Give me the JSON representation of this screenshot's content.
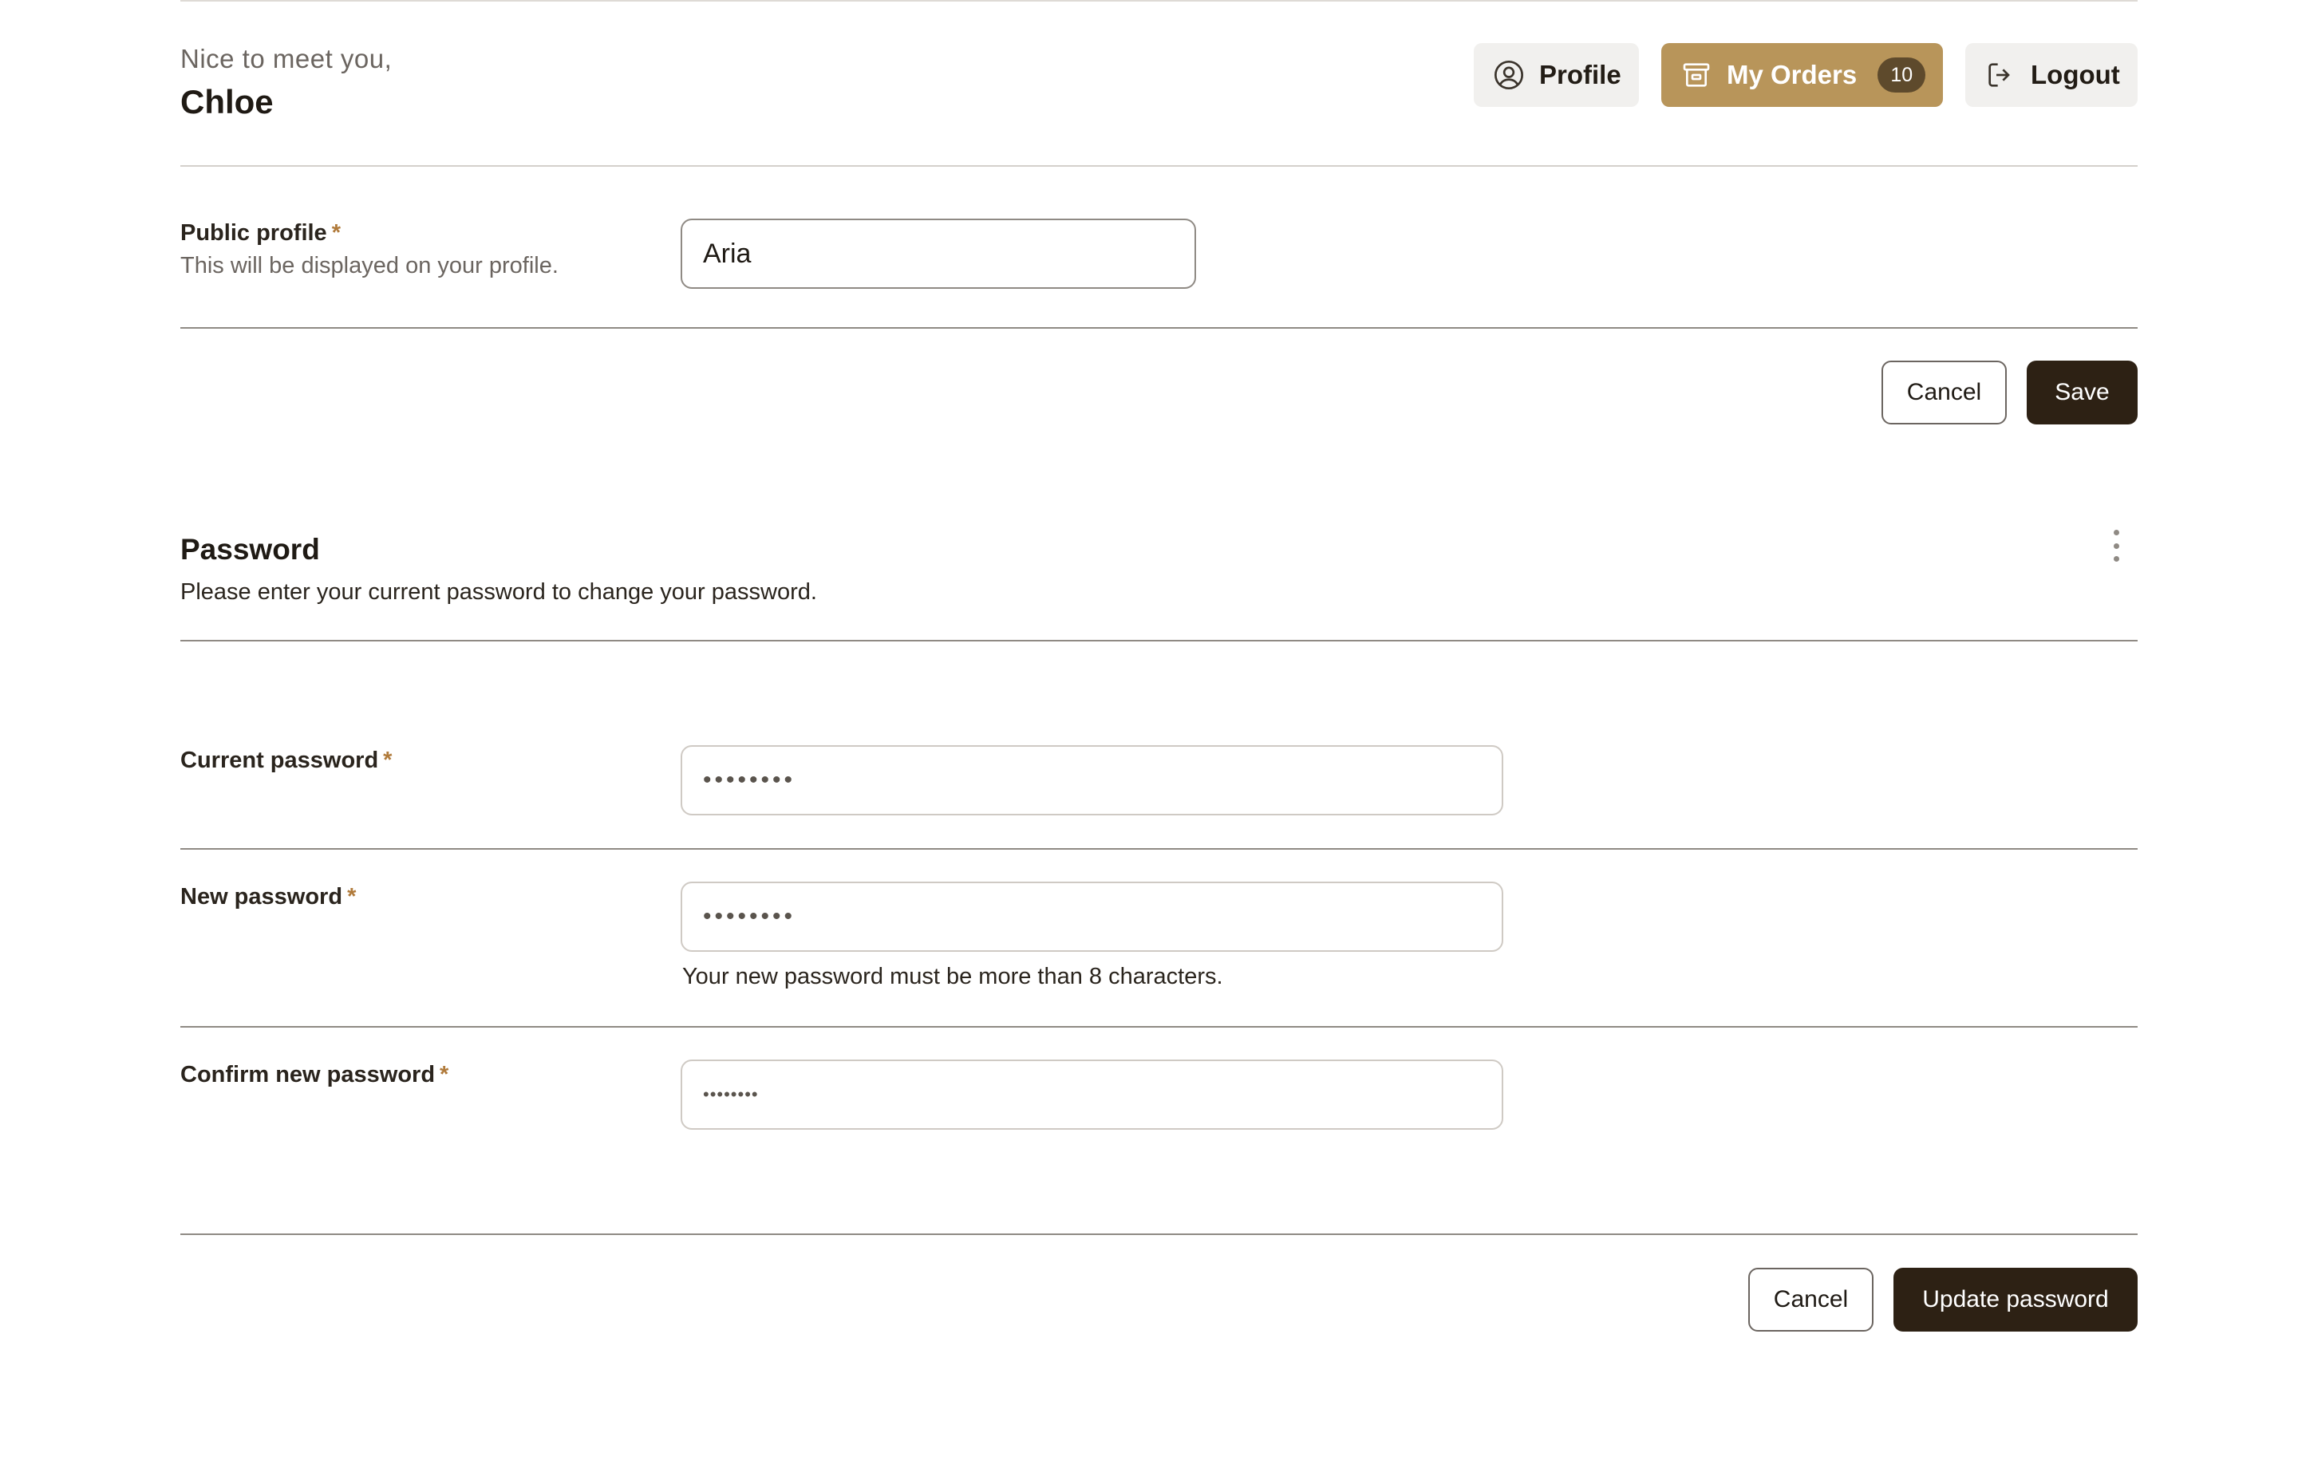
{
  "header": {
    "greeting": "Nice to meet you,",
    "username": "Chloe",
    "nav": {
      "profile_label": "Profile",
      "orders_label": "My Orders",
      "orders_count": "10",
      "logout_label": "Logout"
    }
  },
  "profile_form": {
    "label": "Public profile",
    "required_mark": "*",
    "helper": "This will be displayed on your profile.",
    "value": "Aria",
    "cancel_label": "Cancel",
    "save_label": "Save"
  },
  "password_section": {
    "title": "Password",
    "description": "Please enter your current password to change your password.",
    "current": {
      "label": "Current password",
      "required_mark": "*",
      "value": "••••••••"
    },
    "new": {
      "label": "New password",
      "required_mark": "*",
      "value": "••••••••",
      "hint": "Your new password must be more than 8 characters."
    },
    "confirm": {
      "label": "Confirm new password",
      "required_mark": "*",
      "value": "••••••••"
    },
    "cancel_label": "Cancel",
    "update_label": "Update password"
  },
  "colors": {
    "accent": "#b8955a",
    "primary_button": "#2d2114",
    "required_asterisk": "#b07a3a"
  },
  "icons": {
    "profile": "user-circle-icon",
    "orders": "archive-box-icon",
    "logout": "logout-icon",
    "more": "kebab-menu-icon"
  }
}
